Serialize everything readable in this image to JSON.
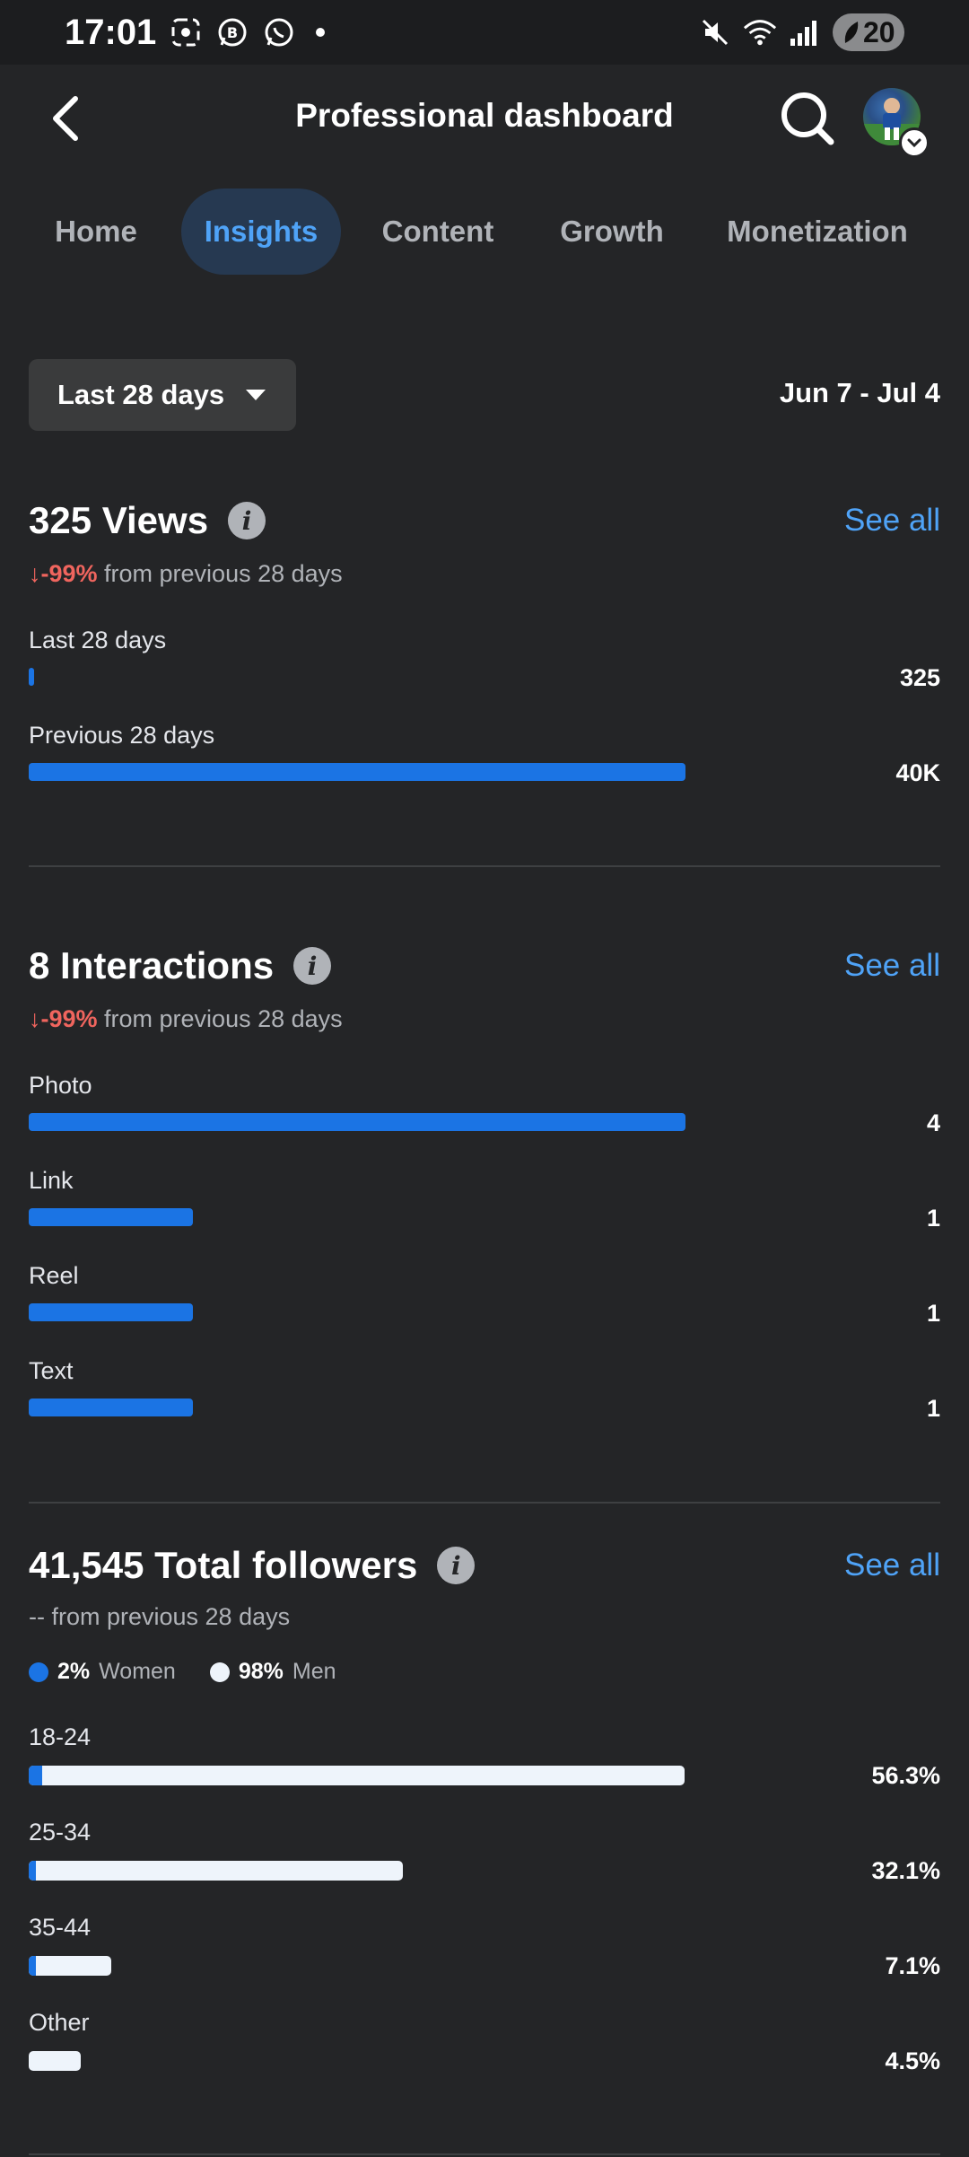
{
  "status_bar": {
    "time": "17:01",
    "battery": "20",
    "icons": [
      "screenshot-icon",
      "whatsapp-business-icon",
      "whatsapp-icon",
      "mute-icon",
      "wifi-icon",
      "signal-icon"
    ]
  },
  "header": {
    "title": "Professional dashboard",
    "back_icon": "chevron-left-icon",
    "search_icon": "search-icon"
  },
  "tabs": [
    {
      "label": "Home",
      "active": false
    },
    {
      "label": "Insights",
      "active": true
    },
    {
      "label": "Content",
      "active": false
    },
    {
      "label": "Growth",
      "active": false
    },
    {
      "label": "Monetization",
      "active": false
    }
  ],
  "filter": {
    "range_label": "Last 28 days",
    "date_range": "Jun 7 - Jul 4"
  },
  "views": {
    "title": "325 Views",
    "see_all": "See all",
    "delta_value": "↓-99%",
    "delta_text": " from previous 28 days",
    "rows": [
      {
        "label": "Last 28 days",
        "value": "325",
        "fraction": 0.008
      },
      {
        "label": "Previous 28 days",
        "value": "40K",
        "fraction": 1.0
      }
    ]
  },
  "interactions": {
    "title": "8 Interactions",
    "see_all": "See all",
    "delta_value": "↓-99%",
    "delta_text": " from previous 28 days",
    "rows": [
      {
        "label": "Photo",
        "value": "4",
        "fraction": 1.0
      },
      {
        "label": "Link",
        "value": "1",
        "fraction": 0.25
      },
      {
        "label": "Reel",
        "value": "1",
        "fraction": 0.25
      },
      {
        "label": "Text",
        "value": "1",
        "fraction": 0.25
      }
    ]
  },
  "followers": {
    "title": "41,545 Total followers",
    "see_all": "See all",
    "delta_text": "-- from previous 28 days",
    "legend": [
      {
        "pct": "2%",
        "label": "Women",
        "color": "#1b74e4"
      },
      {
        "pct": "98%",
        "label": "Men",
        "color": "#eef4fb"
      }
    ],
    "rows": [
      {
        "label": "18-24",
        "value": "56.3%",
        "fraction": 1.0,
        "women_fraction": 0.02
      },
      {
        "label": "25-34",
        "value": "32.1%",
        "fraction": 0.57,
        "women_fraction": 0.02
      },
      {
        "label": "35-44",
        "value": "7.1%",
        "fraction": 0.126,
        "women_fraction": 0.02
      },
      {
        "label": "Other",
        "value": "4.5%",
        "fraction": 0.08,
        "women_fraction": 0.0
      }
    ]
  },
  "colors": {
    "accent": "#4fa3f7",
    "bar": "#1b74e4",
    "negative": "#f0655e",
    "background": "#242527"
  }
}
